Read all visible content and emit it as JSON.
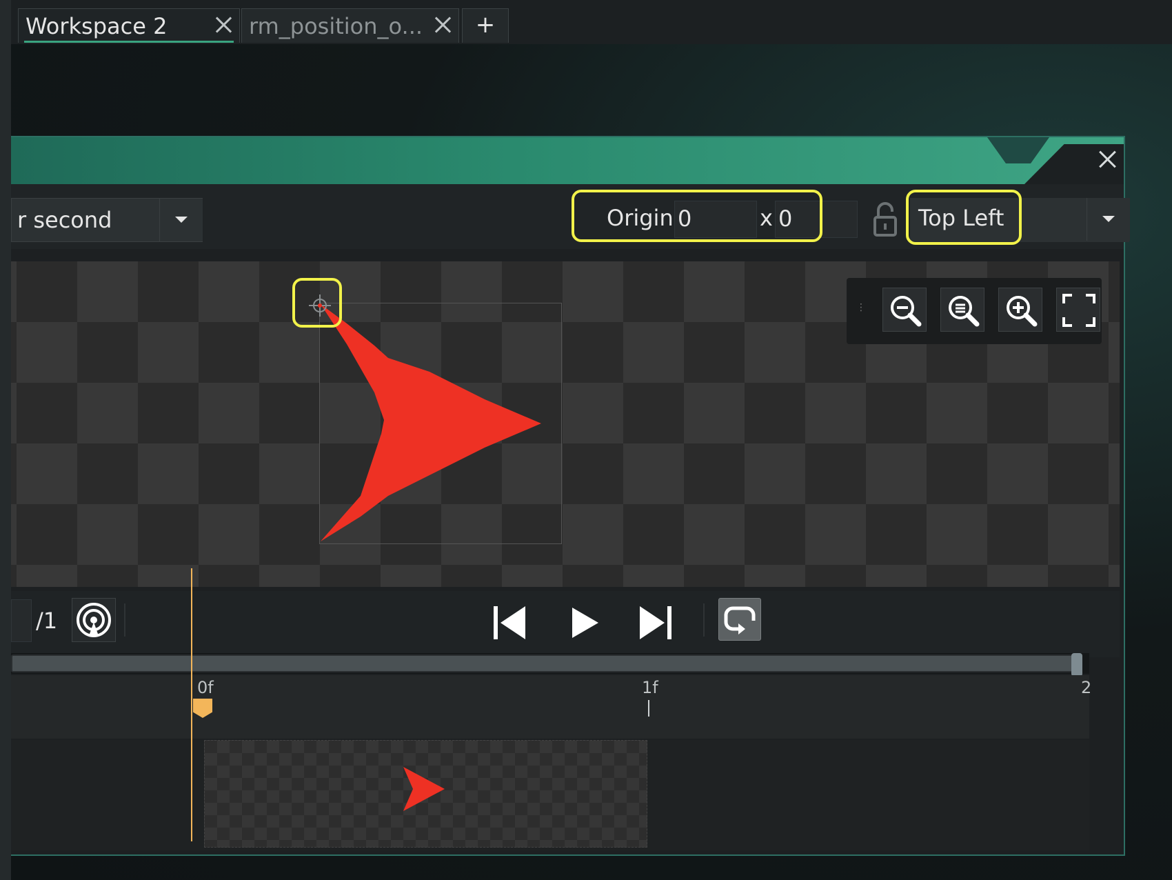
{
  "tabs": [
    {
      "label": "Workspace 2",
      "active": true
    },
    {
      "label": "rm_position_o...",
      "active": false
    }
  ],
  "add_tab_label": "+",
  "toolbar": {
    "speed_text": "r second",
    "origin_label": "Origin",
    "origin_x": "0",
    "x_separator": "x",
    "origin_y": "0",
    "anchor_text": "Top Left"
  },
  "playback": {
    "frame_total": "/1"
  },
  "timeline": {
    "tick_0": "0f",
    "tick_1": "1f",
    "tick_2": "2"
  },
  "colors": {
    "accent": "#3aa480",
    "highlight": "#f2f24a",
    "sprite": "#ee3124",
    "playhead": "#f3b65a"
  }
}
